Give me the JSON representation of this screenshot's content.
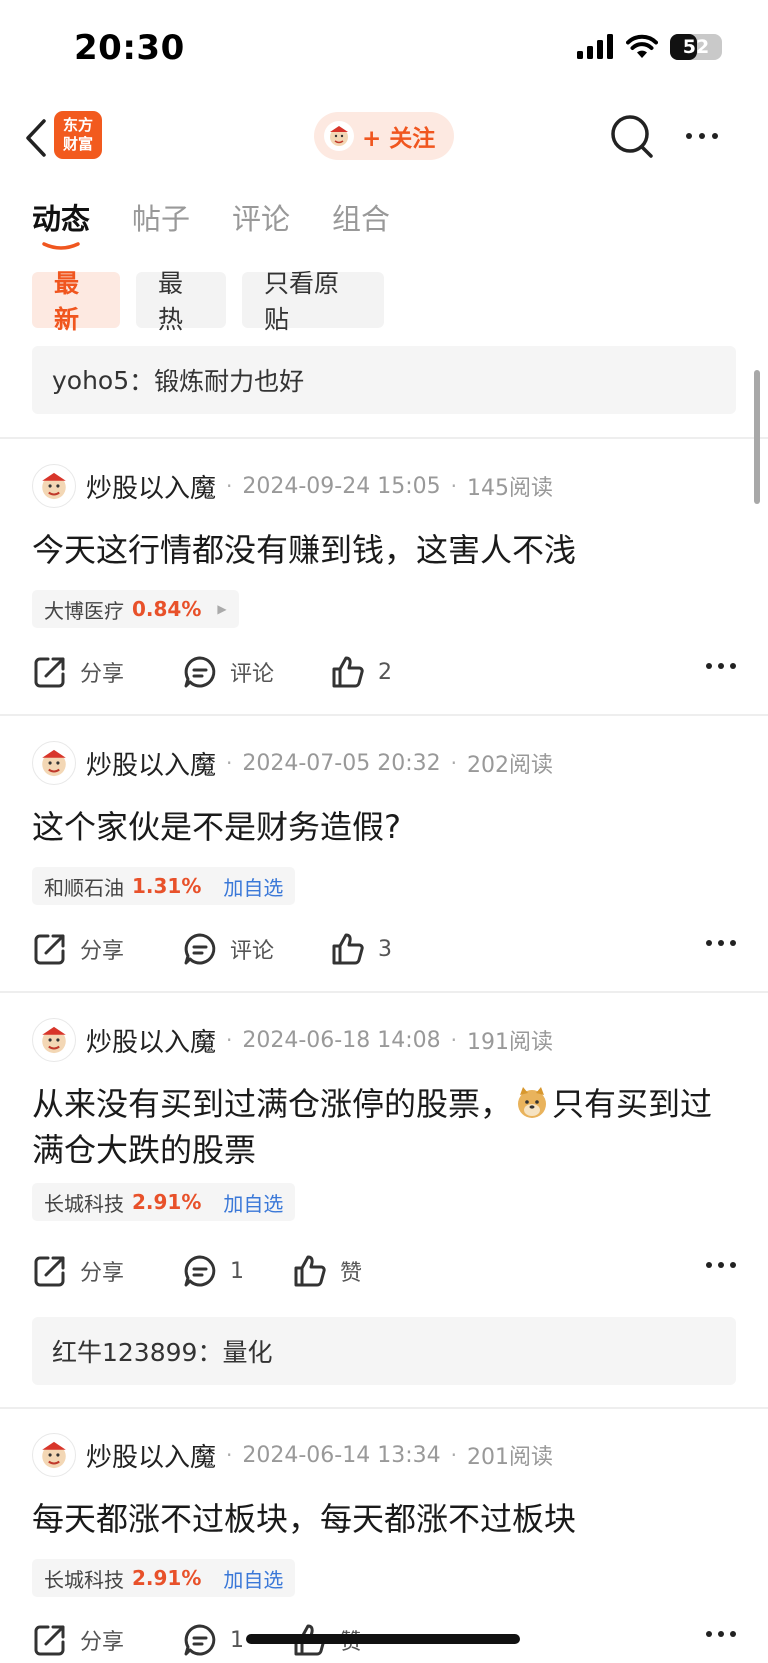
{
  "status_bar": {
    "time": "20:30",
    "battery": "52",
    "battery_level": 0.52
  },
  "nav": {
    "logo_text": "东方\n财富",
    "follow_label": "+ 关注"
  },
  "tabs": [
    {
      "label": "动态",
      "active": true
    },
    {
      "label": "帖子",
      "active": false
    },
    {
      "label": "评论",
      "active": false
    },
    {
      "label": "组合",
      "active": false
    }
  ],
  "filters": [
    {
      "label": "最新",
      "active": true
    },
    {
      "label": "最热",
      "active": false
    },
    {
      "label": "只看原贴",
      "active": false
    }
  ],
  "top_comment": {
    "author": "yoho5",
    "sep": "：",
    "text": "锻炼耐力也好"
  },
  "posts": [
    {
      "author": "炒股以入魔",
      "date": "2024-09-24 15:05",
      "reads": "145阅读",
      "text": "今天这行情都没有赚到钱，这害人不浅",
      "stock": {
        "name": "大博医疗",
        "pct": "0.84%",
        "add": ""
      },
      "actions": {
        "share": "分享",
        "comment": "评论",
        "like": "2"
      }
    },
    {
      "author": "炒股以入魔",
      "date": "2024-07-05 20:32",
      "reads": "202阅读",
      "text": "这个家伙是不是财务造假?",
      "stock": {
        "name": "和顺石油",
        "pct": "1.31%",
        "add": "加自选"
      },
      "actions": {
        "share": "分享",
        "comment": "评论",
        "like": "3"
      }
    },
    {
      "author": "炒股以入魔",
      "date": "2024-06-18 14:08",
      "reads": "191阅读",
      "text_a": "从来没有买到过满仓涨停的股票，",
      "text_b": "只有买到过满仓大跌的股票",
      "stock": {
        "name": "长城科技",
        "pct": "2.91%",
        "add": "加自选"
      },
      "actions": {
        "share": "分享",
        "comment": "1",
        "like": "赞"
      },
      "reply": {
        "author": "红牛123899",
        "sep": "：",
        "text": "量化"
      }
    },
    {
      "author": "炒股以入魔",
      "date": "2024-06-14 13:34",
      "reads": "201阅读",
      "text": "每天都涨不过板块，每天都涨不过板块",
      "stock": {
        "name": "长城科技",
        "pct": "2.91%",
        "add": "加自选"
      },
      "actions": {
        "share": "分享",
        "comment": "1",
        "like": "赞"
      }
    }
  ],
  "colors": {
    "accent": "#f0561f",
    "link": "#3a78d8",
    "up": "#e8512a"
  },
  "icons": [
    "back-icon",
    "search-icon",
    "more-icon",
    "share-icon",
    "comment-icon",
    "like-icon",
    "signal-icon",
    "wifi-icon",
    "battery-icon"
  ]
}
